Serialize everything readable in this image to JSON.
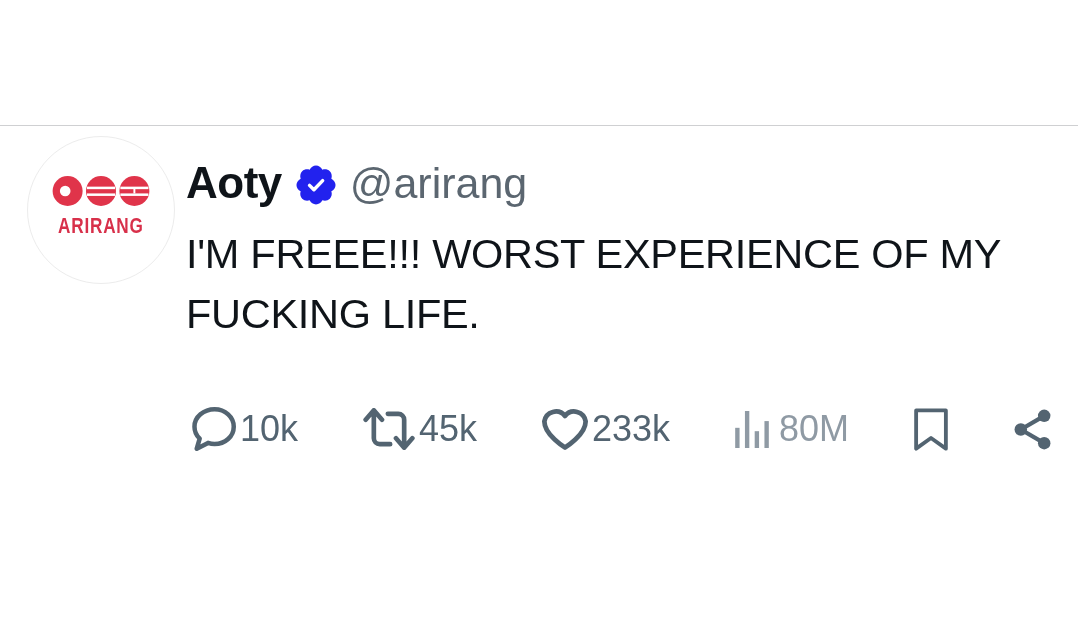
{
  "tweet": {
    "avatar": {
      "logo_text": "ARIRANG"
    },
    "author": {
      "name": "Aoty",
      "verified": true,
      "handle": "@arirang"
    },
    "text": "I'M FREEE!!! WORST EXPERIENCE OF MY FUCKING LIFE.",
    "actions": [
      {
        "kind": "reply",
        "count": "10k"
      },
      {
        "kind": "repost",
        "count": "45k"
      },
      {
        "kind": "like",
        "count": "233k"
      },
      {
        "kind": "views",
        "count": "80M"
      },
      {
        "kind": "bookmark"
      },
      {
        "kind": "share"
      }
    ]
  }
}
